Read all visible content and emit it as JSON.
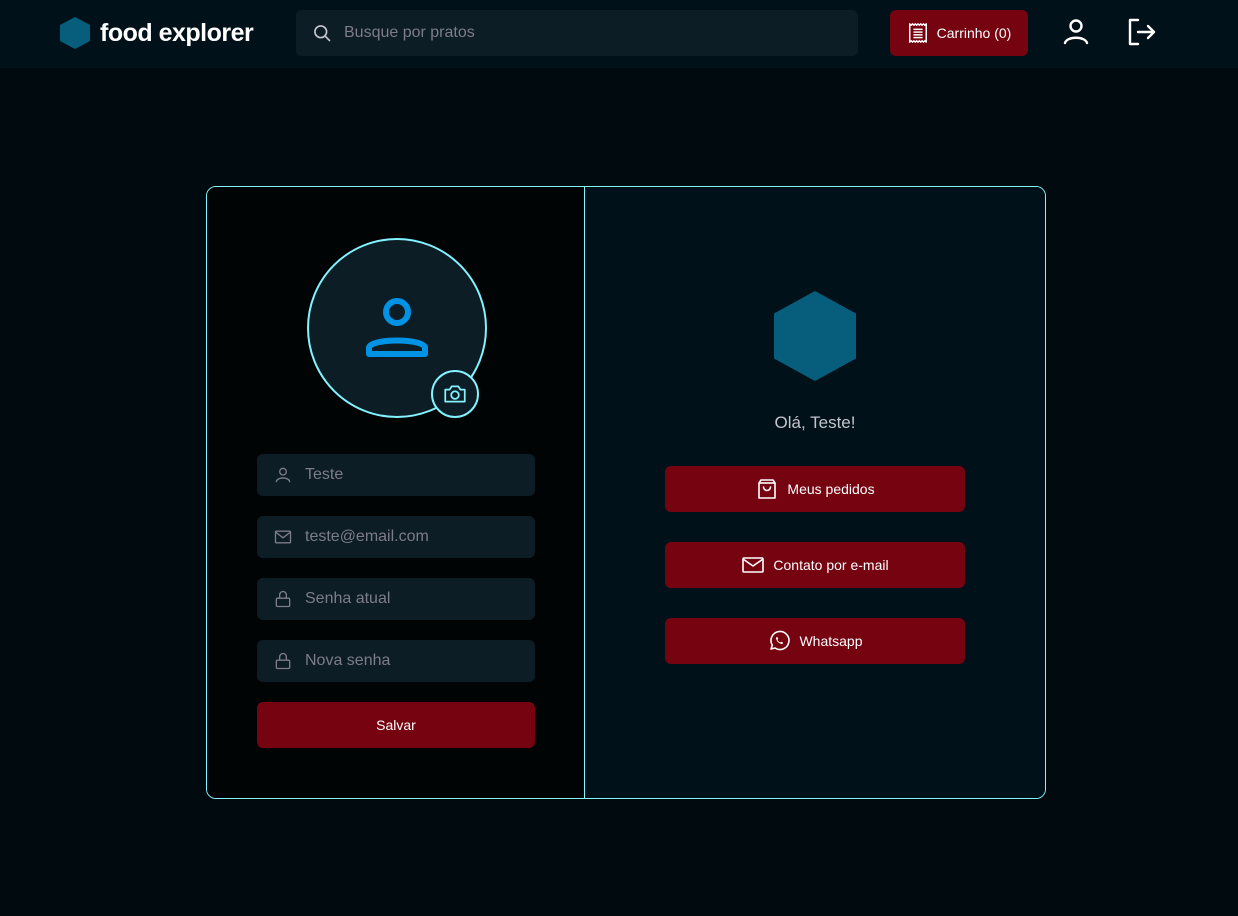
{
  "header": {
    "brand": "food explorer",
    "search_placeholder": "Busque por pratos",
    "cart_label": "Carrinho (0)"
  },
  "profile_form": {
    "name_placeholder": "Teste",
    "email_placeholder": "teste@email.com",
    "current_password_placeholder": "Senha atual",
    "new_password_placeholder": "Nova senha",
    "save_label": "Salvar"
  },
  "welcome": {
    "greeting": "Olá, Teste!",
    "orders_label": "Meus pedidos",
    "email_contact_label": "Contato por e-mail",
    "whatsapp_label": "Whatsapp"
  },
  "colors": {
    "accent_red": "#750310",
    "accent_cyan": "#82f3ff",
    "brand_blue": "#065e7c",
    "icon_blue": "#0092e4"
  },
  "icons": [
    "hexagon-logo-icon",
    "search-icon",
    "receipt-icon",
    "user-icon",
    "sign-out-icon",
    "camera-icon",
    "mail-icon",
    "lock-icon",
    "shopping-bag-icon",
    "whatsapp-icon"
  ]
}
